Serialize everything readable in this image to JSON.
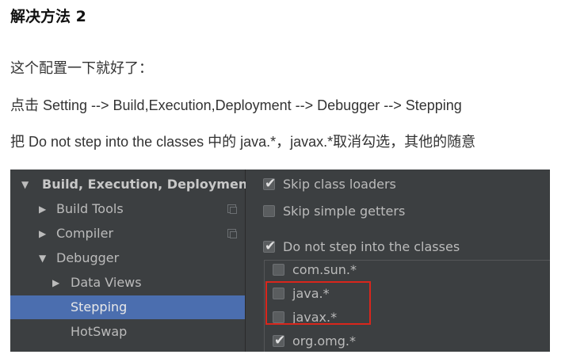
{
  "article": {
    "heading": "解决方法 2",
    "p1": "这个配置一下就好了：",
    "p2": "点击 Setting --> Build,Execution,Deployment --> Debugger --> Stepping",
    "p3": "把 Do not step into the classes 中的 java.*，javax.*取消勾选，其他的随意"
  },
  "settings": {
    "tree": [
      {
        "label": "Build, Execution, Deployment",
        "arrow": "▼"
      },
      {
        "label": "Build Tools",
        "arrow": "▶"
      },
      {
        "label": "Compiler",
        "arrow": "▶"
      },
      {
        "label": "Debugger",
        "arrow": "▼"
      },
      {
        "label": "Data Views",
        "arrow": "▶"
      },
      {
        "label": "Stepping",
        "arrow": ""
      },
      {
        "label": "HotSwap",
        "arrow": ""
      }
    ],
    "options": [
      {
        "label": "Skip class loaders",
        "checked": true
      },
      {
        "label": "Skip simple getters",
        "checked": false
      },
      {
        "label": "Do not step into the classes",
        "checked": true
      }
    ],
    "classes": [
      {
        "label": "com.sun.*",
        "checked": false
      },
      {
        "label": "java.*",
        "checked": false
      },
      {
        "label": "javax.*",
        "checked": false
      },
      {
        "label": "org.omg.*",
        "checked": true
      }
    ],
    "colors": {
      "panel_bg": "#3c3f41",
      "selection": "#4b6eaf",
      "highlight_border": "#d9261c"
    }
  }
}
